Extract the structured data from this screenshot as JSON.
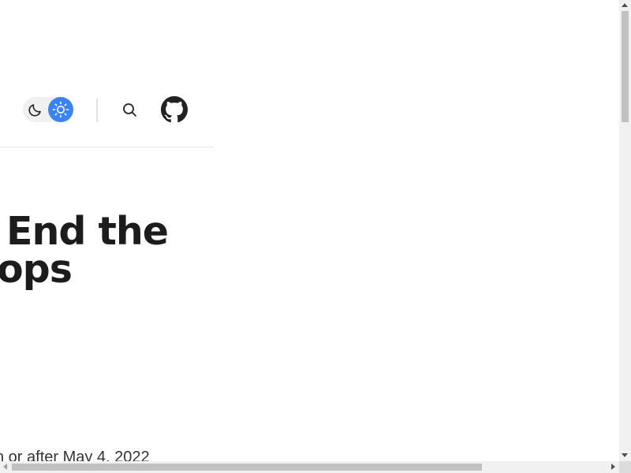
{
  "header": {
    "theme_toggle": {
      "options": [
        {
          "icon": "moon-icon",
          "selected": false
        },
        {
          "icon": "sun-icon",
          "selected": true
        }
      ],
      "accent_color": "#3b82f6"
    },
    "search": {
      "icon": "search-icon"
    },
    "github": {
      "icon": "github-icon"
    }
  },
  "main": {
    "title_line1": "End the",
    "title_line2": "ops",
    "date_text": "n or after May 4, 2022"
  },
  "scrollbars": {
    "vertical": {
      "visible": true
    },
    "horizontal": {
      "visible": true
    }
  }
}
